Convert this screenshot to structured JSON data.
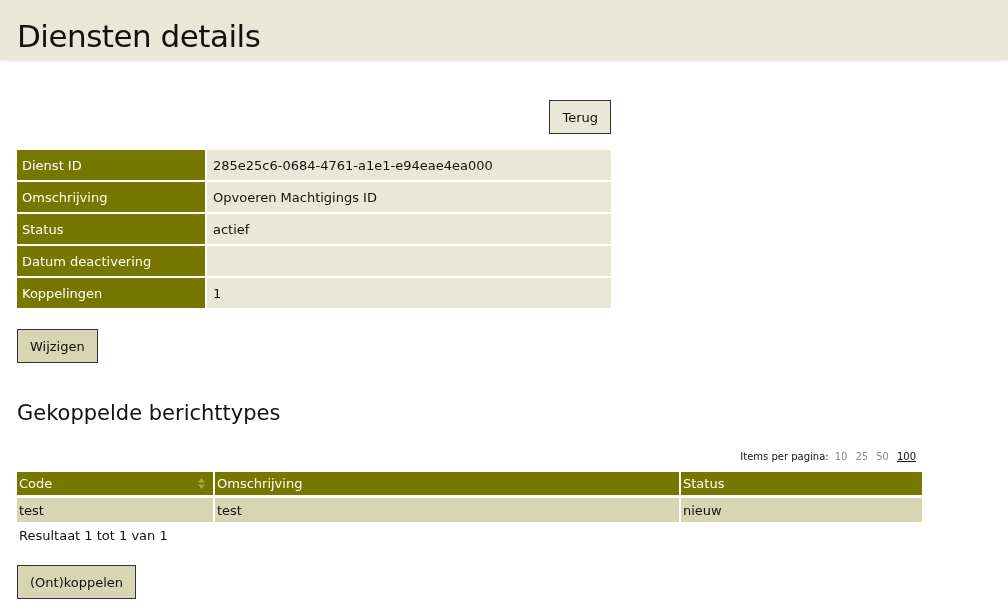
{
  "header": {
    "title": "Diensten details"
  },
  "back_button": "Terug",
  "details": [
    {
      "label": "Dienst ID",
      "value": "285e25c6-0684-4761-a1e1-e94eae4ea000"
    },
    {
      "label": "Omschrijving",
      "value": "Opvoeren Machtigings ID"
    },
    {
      "label": "Status",
      "value": "actief"
    },
    {
      "label": "Datum deactivering"
    },
    {
      "label": "Koppelingen",
      "value": "1"
    }
  ],
  "edit_button": "Wijzigen",
  "section_title": "Gekoppelde berichttypes",
  "pagination": {
    "label": "Items per pagina:",
    "options": [
      {
        "label": "10",
        "selected": false
      },
      {
        "label": "25",
        "selected": false
      },
      {
        "label": "50",
        "selected": false
      },
      {
        "label": "100",
        "selected": true
      }
    ]
  },
  "table": {
    "columns": [
      {
        "label": "Code",
        "sortable": true
      },
      {
        "label": "Omschrijving",
        "sortable": false
      },
      {
        "label": "Status",
        "sortable": false
      }
    ],
    "rows": [
      [
        "test",
        "test",
        "nieuw"
      ]
    ]
  },
  "result_text": "Resultaat 1 tot 1 van 1",
  "link_button": "(Ont)koppelen"
}
